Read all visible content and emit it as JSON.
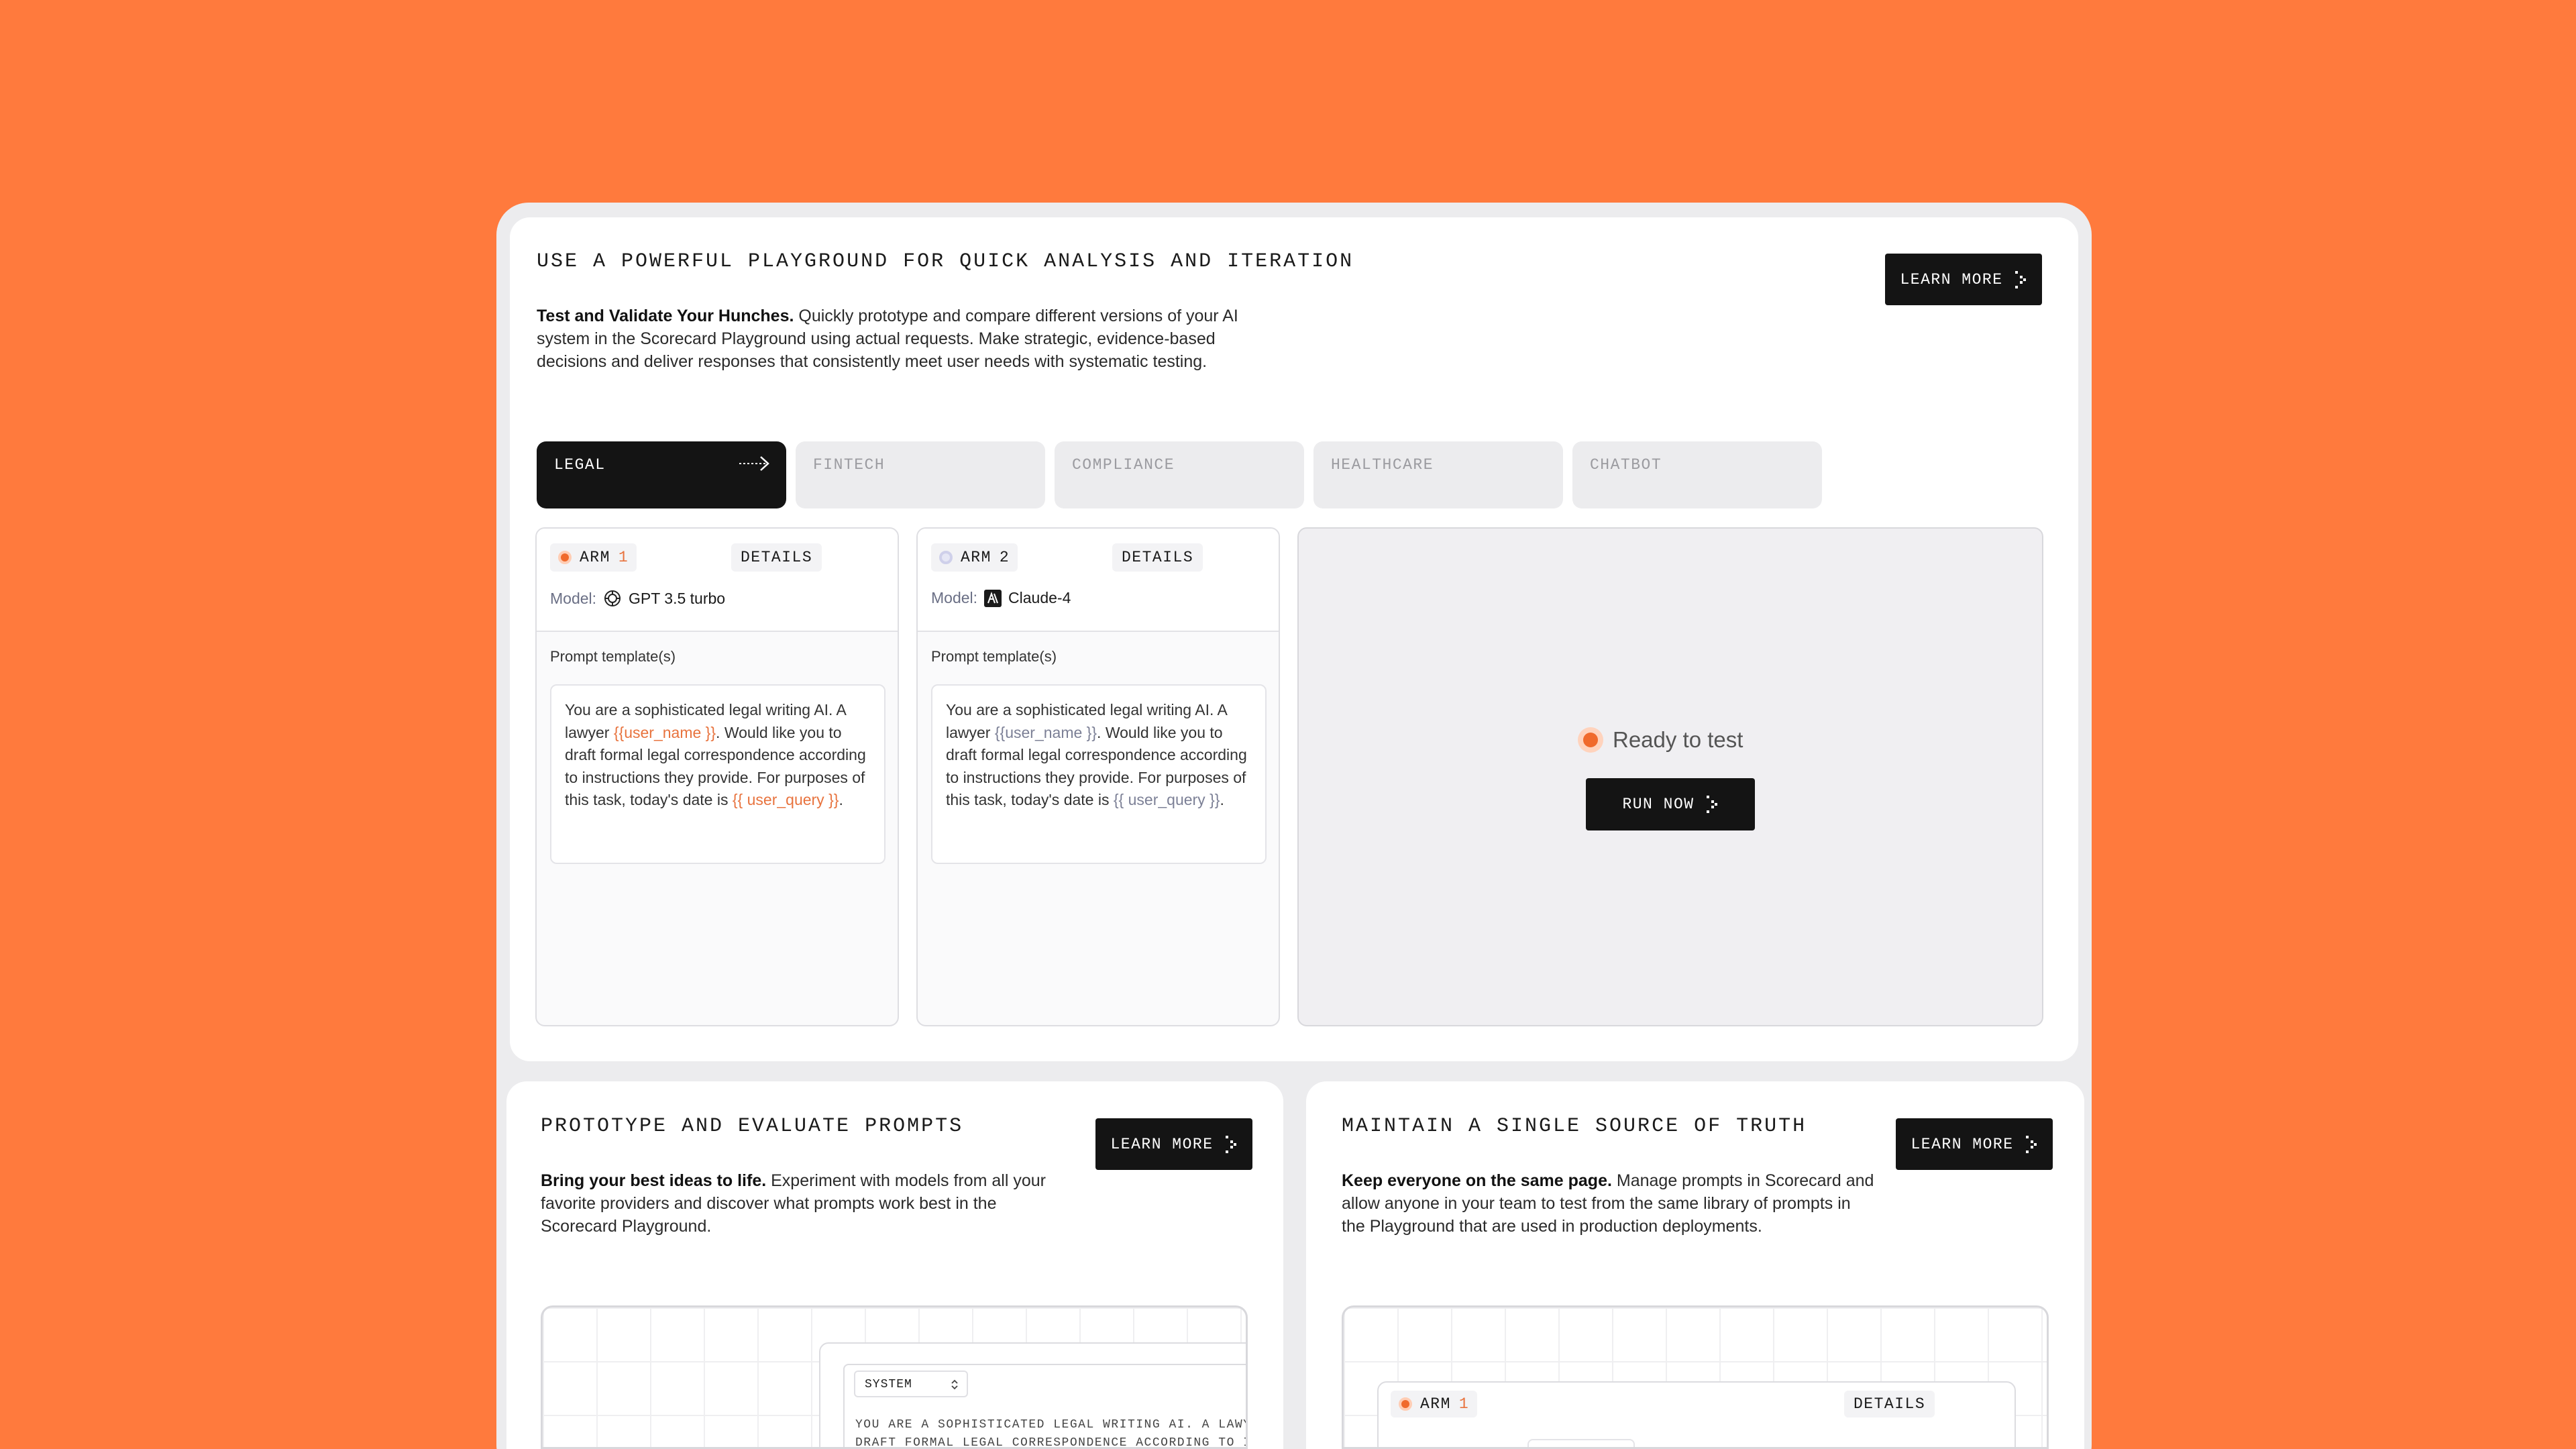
{
  "hero": {
    "heading": "USE A POWERFUL PLAYGROUND FOR QUICK ANALYSIS AND ITERATION",
    "lead": "Test and Validate Your Hunches.",
    "body": " Quickly prototype and compare different versions of your AI system in the Scorecard Playground using actual requests. Make strategic, evidence-based decisions and deliver responses that consistently meet user needs with systematic testing.",
    "learn_more": "LEARN MORE"
  },
  "tabs": [
    {
      "label": "LEGAL",
      "active": true
    },
    {
      "label": "FINTECH",
      "active": false
    },
    {
      "label": "COMPLIANCE",
      "active": false
    },
    {
      "label": "HEALTHCARE",
      "active": false
    },
    {
      "label": "CHATBOT",
      "active": false
    }
  ],
  "arms": [
    {
      "arm_label": "ARM",
      "arm_number": "1",
      "dot_color": "#f4a57a",
      "details": "DETAILS",
      "model_label": "Model:",
      "model_icon": "openai-icon",
      "model_name": "GPT 3.5 turbo",
      "prompt_label": "Prompt template(s)",
      "prompt_pre": "You are a sophisticated legal writing AI. A lawyer ",
      "var1": "{{user_name }}",
      "prompt_mid": ". Would like you to draft formal legal correspondence according to instructions they provide. For purposes of this task, today's date is ",
      "var2": "{{ user_query }}",
      "prompt_post": "."
    },
    {
      "arm_label": "ARM",
      "arm_number": "2",
      "dot_color": "#cfd0ea",
      "details": "DETAILS",
      "model_label": "Model:",
      "model_icon": "anthropic-icon",
      "model_name": "Claude-4",
      "prompt_label": "Prompt template(s)",
      "prompt_pre": "You are a sophisticated legal writing AI. A lawyer ",
      "var1": "{{user_name }}",
      "prompt_mid": ". Would like you to draft formal legal correspondence according to instructions they provide. For purposes of this task, today's date is ",
      "var2": "{{ user_query }}",
      "prompt_post": "."
    }
  ],
  "run": {
    "status": "Ready to test",
    "button": "RUN NOW"
  },
  "prototype": {
    "heading": "PROTOTYPE AND EVALUATE PROMPTS",
    "lead": "Bring your best ideas to life.",
    "body": " Experiment with models from all your favorite providers and discover what prompts work best in the Scorecard Playground.",
    "learn_more": "LEARN MORE",
    "preview_select": "SYSTEM",
    "preview_line1": "YOU ARE A SOPHISTICATED LEGAL WRITING AI. A LAWYER",
    "preview_line2": "DRAFT FORMAL LEGAL CORRESPONDENCE ACCORDING TO INS"
  },
  "truth": {
    "heading": "MAINTAIN A SINGLE SOURCE OF TRUTH",
    "lead": "Keep everyone on the same page.",
    "body": " Manage prompts in Scorecard and allow anyone in your team to test from the same library of prompts in the Playground that are used in production deployments.",
    "learn_more": "LEARN MORE",
    "preview_arm": "ARM",
    "preview_arm_number": "1",
    "preview_details": "DETAILS"
  },
  "colors": {
    "background": "#FF7A3D",
    "dark_button": "#141414",
    "accent_orange": "#e8733e"
  }
}
